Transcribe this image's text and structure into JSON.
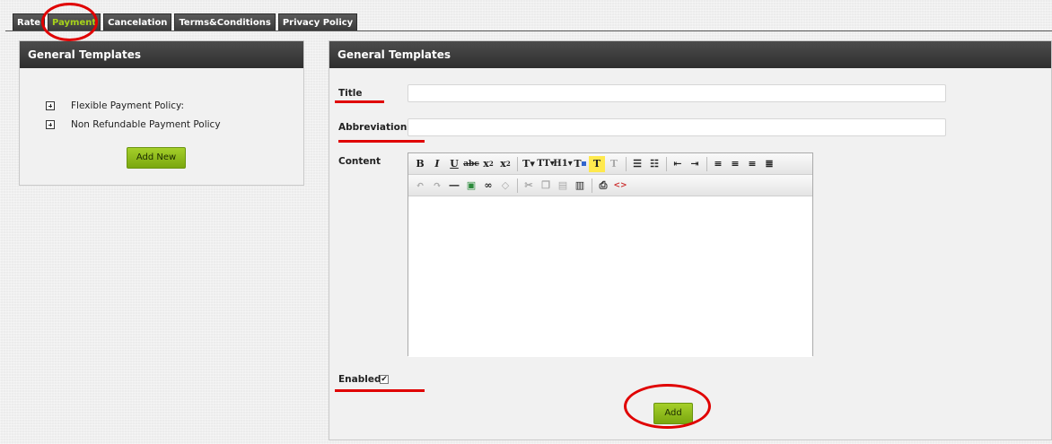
{
  "tabs": [
    {
      "label": "Rate",
      "active": false
    },
    {
      "label": "Payment",
      "active": true
    },
    {
      "label": "Cancelation",
      "active": false
    },
    {
      "label": "Terms&Conditions",
      "active": false
    },
    {
      "label": "Privacy Policy",
      "active": false
    }
  ],
  "left_panel": {
    "title": "General Templates",
    "items": [
      {
        "label": "Flexible Payment Policy:"
      },
      {
        "label": "Non Refundable Payment Policy"
      }
    ],
    "add_new_label": "Add New"
  },
  "right_panel": {
    "title": "General Templates",
    "title_label": "Title",
    "title_value": "",
    "abbreviation_label": "Abbreviation",
    "abbreviation_value": "",
    "content_label": "Content",
    "enabled_label": "Enabled",
    "enabled_checked": true,
    "add_label": "Add"
  },
  "editor_toolbar": {
    "row1": [
      "bold-icon",
      "italic-icon",
      "underline-icon",
      "strikethrough-icon",
      "subscript-icon",
      "superscript-icon",
      "font-family-icon",
      "font-size-icon",
      "heading-icon",
      "text-color-icon",
      "highlight-icon",
      "clear-format-icon",
      "bullet-list-icon",
      "numbered-list-icon",
      "outdent-icon",
      "indent-icon",
      "align-left-icon",
      "align-center-icon",
      "align-right-icon",
      "justify-icon"
    ],
    "row2": [
      "undo-icon",
      "redo-icon",
      "horizontal-rule-icon",
      "image-icon",
      "link-icon",
      "unlink-icon",
      "cut-icon",
      "copy-icon",
      "paste-icon",
      "paste-word-icon",
      "print-icon",
      "source-code-icon"
    ]
  },
  "colors": {
    "active_tab_text": "#a6d21a",
    "annotation_red": "#e00000",
    "button_green": "#8fbc1c"
  }
}
